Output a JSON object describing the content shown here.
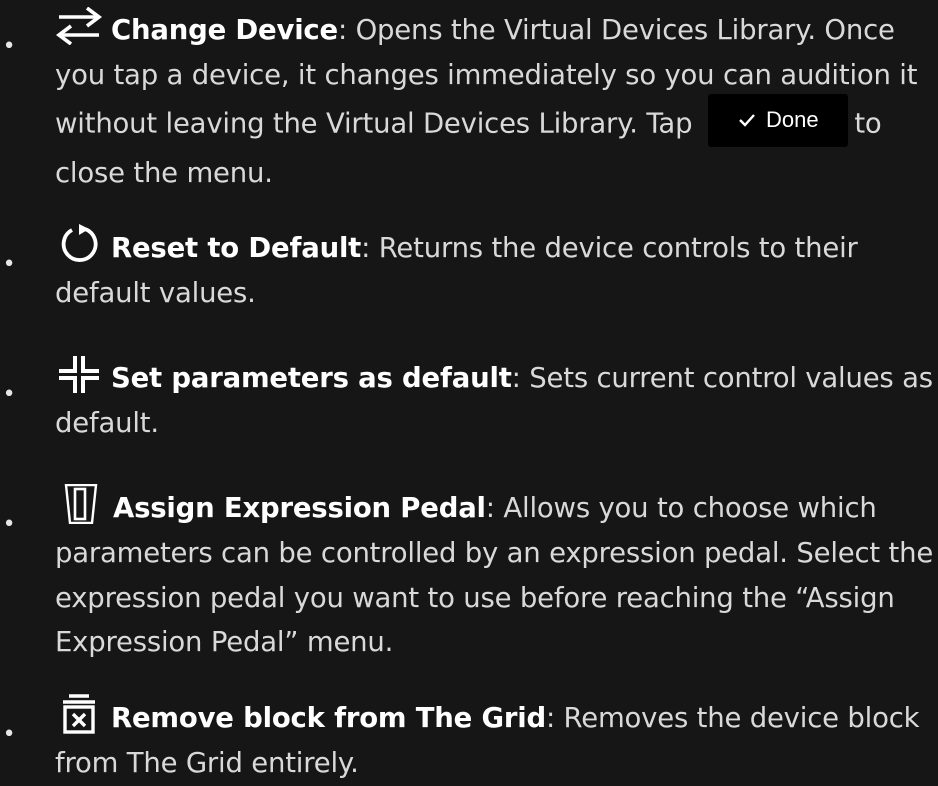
{
  "items": [
    {
      "icon": "swap-arrows-icon",
      "term": "Change Device",
      "desc_before": ": Opens the Virtual Devices Library. Once you tap a device, it changes immediately so you can audition it without leaving the Virtual Devices Library. Tap",
      "desc_after": "to close the menu."
    },
    {
      "icon": "reset-icon",
      "term": "Reset to Default",
      "desc": ": Returns the device controls to their default values."
    },
    {
      "icon": "set-default-icon",
      "term": "Set parameters as default",
      "desc": ": Sets current control values as default."
    },
    {
      "icon": "expression-pedal-icon",
      "term": "Assign Expression Pedal",
      "desc": ": Allows you to choose which parameters can be controlled by an expression pedal. Select the expression pedal you want to use before reaching the “Assign Expression Pedal” menu."
    },
    {
      "icon": "remove-block-icon",
      "term": "Remove block from The Grid",
      "desc": ": Removes the device block from The Grid entirely."
    }
  ],
  "done_button": {
    "label": "Done",
    "icon": "checkmark-icon"
  },
  "bullet": "•"
}
